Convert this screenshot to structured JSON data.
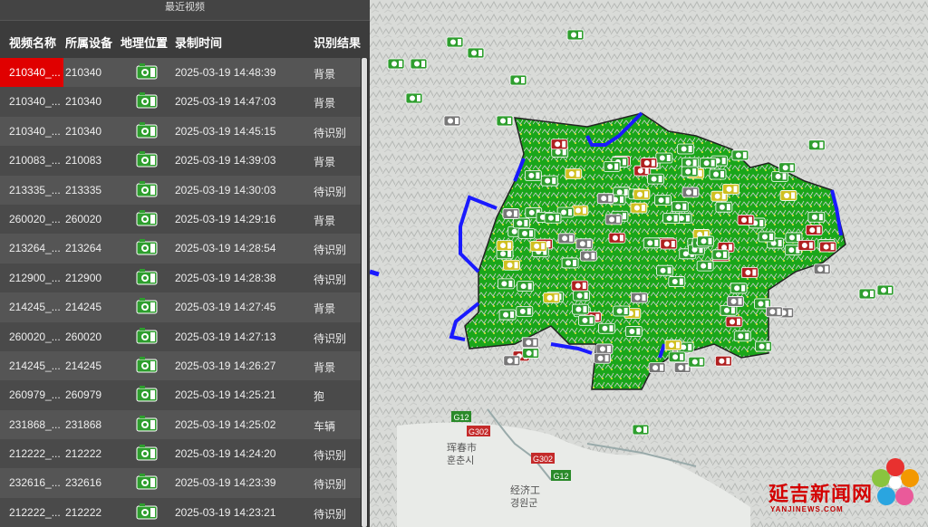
{
  "panel": {
    "title": "最近视频"
  },
  "columns": [
    "视频名称",
    "所属设备",
    "地理位置",
    "录制时间",
    "识别结果"
  ],
  "rows": [
    {
      "name": "210340_...",
      "device": "210340",
      "time": "2025-03-19 14:48:39",
      "result": "背景"
    },
    {
      "name": "210340_...",
      "device": "210340",
      "time": "2025-03-19 14:47:03",
      "result": "背景"
    },
    {
      "name": "210340_...",
      "device": "210340",
      "time": "2025-03-19 14:45:15",
      "result": "待识别"
    },
    {
      "name": "210083_...",
      "device": "210083",
      "time": "2025-03-19 14:39:03",
      "result": "背景"
    },
    {
      "name": "213335_...",
      "device": "213335",
      "time": "2025-03-19 14:30:03",
      "result": "待识别"
    },
    {
      "name": "260020_...",
      "device": "260020",
      "time": "2025-03-19 14:29:16",
      "result": "背景"
    },
    {
      "name": "213264_...",
      "device": "213264",
      "time": "2025-03-19 14:28:54",
      "result": "待识别"
    },
    {
      "name": "212900_...",
      "device": "212900",
      "time": "2025-03-19 14:28:38",
      "result": "待识别"
    },
    {
      "name": "214245_...",
      "device": "214245",
      "time": "2025-03-19 14:27:45",
      "result": "背景"
    },
    {
      "name": "260020_...",
      "device": "260020",
      "time": "2025-03-19 14:27:13",
      "result": "待识别"
    },
    {
      "name": "214245_...",
      "device": "214245",
      "time": "2025-03-19 14:26:27",
      "result": "背景"
    },
    {
      "name": "260979_...",
      "device": "260979",
      "time": "2025-03-19 14:25:21",
      "result": "狍"
    },
    {
      "name": "231868_...",
      "device": "231868",
      "time": "2025-03-19 14:25:02",
      "result": "车辆"
    },
    {
      "name": "212222_...",
      "device": "212222",
      "time": "2025-03-19 14:24:20",
      "result": "待识别"
    },
    {
      "name": "232616_...",
      "device": "232616",
      "time": "2025-03-19 14:23:39",
      "result": "待识别"
    },
    {
      "name": "212222_...",
      "device": "212222",
      "time": "2025-03-19 14:23:21",
      "result": "待识别"
    }
  ],
  "selected_row": 0,
  "map": {
    "labels": {
      "g12": "G12",
      "g302": "G302",
      "g302b": "G302",
      "g12b": "G12",
      "hunchun": "珲春市",
      "hunchun_kr": "훈춘시",
      "city2": "经济工",
      "city2_kr": "경원군"
    }
  },
  "logo": {
    "text": "延吉新闻网",
    "sub": "YANJINEWS.COM"
  },
  "colors": {
    "selected": "#e00000",
    "boundary": "#1a1aff",
    "camera": "#2e9e2e",
    "land": "#18b418"
  }
}
